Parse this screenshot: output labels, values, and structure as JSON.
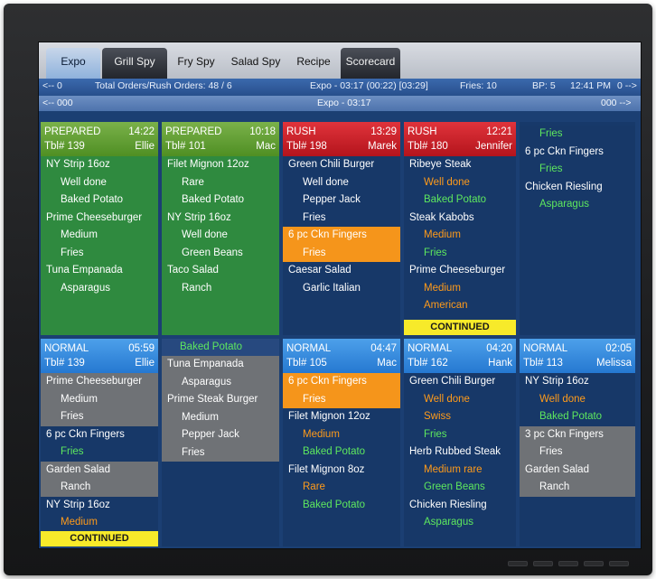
{
  "tabs": [
    {
      "label": "Expo",
      "style": "active"
    },
    {
      "label": "Grill Spy",
      "style": "dark"
    },
    {
      "label": "Fry Spy",
      "style": "plain"
    },
    {
      "label": "Salad Spy",
      "style": "plain"
    },
    {
      "label": "Recipe",
      "style": "plain"
    },
    {
      "label": "Scorecard",
      "style": "dark"
    }
  ],
  "infobar1": {
    "left_nav": "<-- 0",
    "orders": "Total Orders/Rush Orders: 48 / 6",
    "expo_time": "Expo  - 03:17 (00:22) [03:29]",
    "fries": "Fries: 10",
    "bp": "BP: 5",
    "clock": "12:41 PM",
    "right_nav": "0 -->"
  },
  "infobar2": {
    "left_nav": "<-- 000",
    "center": "Expo - 03:17",
    "right_nav": "000 -->"
  },
  "row1": [
    {
      "status": "PREPARED",
      "time": "14:22",
      "table": "Tbl# 139",
      "server": "Ellie",
      "header_color": "prep",
      "items": [
        {
          "text": "NY Strip 16oz",
          "level": 1,
          "color": "white"
        },
        {
          "text": "Well done",
          "level": 2,
          "color": "white"
        },
        {
          "text": "Baked Potato",
          "level": 2,
          "color": "white"
        },
        {
          "text": "Prime Cheeseburger",
          "level": 1,
          "color": "white"
        },
        {
          "text": "Medium",
          "level": 2,
          "color": "white"
        },
        {
          "text": "Fries",
          "level": 2,
          "color": "white"
        },
        {
          "text": "Tuna Empanada",
          "level": 1,
          "color": "white"
        },
        {
          "text": "Asparagus",
          "level": 2,
          "color": "white"
        }
      ]
    },
    {
      "status": "PREPARED",
      "time": "10:18",
      "table": "Tbl# 101",
      "server": "Mac",
      "header_color": "prep",
      "items": [
        {
          "text": "Filet Mignon 12oz",
          "level": 1,
          "color": "white"
        },
        {
          "text": "Rare",
          "level": 2,
          "color": "white"
        },
        {
          "text": "Baked Potato",
          "level": 2,
          "color": "white"
        },
        {
          "text": "NY Strip 16oz",
          "level": 1,
          "color": "white"
        },
        {
          "text": "Well done",
          "level": 2,
          "color": "white"
        },
        {
          "text": "Green Beans",
          "level": 2,
          "color": "white"
        },
        {
          "text": "Taco Salad",
          "level": 1,
          "color": "white"
        },
        {
          "text": "Ranch",
          "level": 2,
          "color": "white"
        }
      ]
    },
    {
      "status": "RUSH",
      "time": "13:29",
      "table": "Tbl# 198",
      "server": "Marek",
      "header_color": "rush",
      "items": [
        {
          "text": "Green Chili Burger",
          "level": 1,
          "color": "white"
        },
        {
          "text": "Well done",
          "level": 2,
          "color": "white"
        },
        {
          "text": "Pepper Jack",
          "level": 2,
          "color": "white"
        },
        {
          "text": "Fries",
          "level": 2,
          "color": "white"
        },
        {
          "text": "6 pc Ckn Fingers",
          "level": 1,
          "color": "white",
          "bg": "orange"
        },
        {
          "text": "Fries",
          "level": 2,
          "color": "white",
          "bg": "orange"
        },
        {
          "text": "Caesar Salad",
          "level": 1,
          "color": "white"
        },
        {
          "text": "Garlic Italian",
          "level": 2,
          "color": "white"
        }
      ]
    },
    {
      "status": "RUSH",
      "time": "12:21",
      "table": "Tbl# 180",
      "server": "Jennifer",
      "header_color": "rush",
      "continued": "CONTINUED",
      "items": [
        {
          "text": "Ribeye Steak",
          "level": 1,
          "color": "white"
        },
        {
          "text": "Well done",
          "level": 2,
          "color": "orange"
        },
        {
          "text": "Baked Potato",
          "level": 2,
          "color": "green"
        },
        {
          "text": "Steak Kabobs",
          "level": 1,
          "color": "white"
        },
        {
          "text": "Medium",
          "level": 2,
          "color": "orange"
        },
        {
          "text": "Fries",
          "level": 2,
          "color": "green"
        },
        {
          "text": "Prime Cheeseburger",
          "level": 1,
          "color": "white"
        },
        {
          "text": "Medium",
          "level": 2,
          "color": "orange"
        },
        {
          "text": "American",
          "level": 2,
          "color": "orange"
        }
      ]
    },
    {
      "status": "",
      "time": "",
      "table": "",
      "server": "",
      "header_color": "none",
      "items": [
        {
          "text": "Fries",
          "level": 2,
          "color": "green"
        },
        {
          "text": "6 pc Ckn Fingers",
          "level": 1,
          "color": "white"
        },
        {
          "text": "Fries",
          "level": 2,
          "color": "green"
        },
        {
          "text": "Chicken Riesling",
          "level": 1,
          "color": "white"
        },
        {
          "text": "Asparagus",
          "level": 2,
          "color": "green"
        }
      ]
    }
  ],
  "row2": [
    {
      "status": "NORMAL",
      "time": "05:59",
      "table": "Tbl# 139",
      "server": "Ellie",
      "header_color": "normal",
      "continued": "CONTINUED",
      "items": [
        {
          "text": "Prime Cheeseburger",
          "level": 1,
          "color": "white",
          "bg": "gray"
        },
        {
          "text": "Medium",
          "level": 2,
          "color": "white",
          "bg": "gray"
        },
        {
          "text": "Fries",
          "level": 2,
          "color": "white",
          "bg": "gray"
        },
        {
          "text": "6 pc Ckn Fingers",
          "level": 1,
          "color": "white"
        },
        {
          "text": "Fries",
          "level": 2,
          "color": "green"
        },
        {
          "text": "Garden Salad",
          "level": 1,
          "color": "white",
          "bg": "gray"
        },
        {
          "text": "Ranch",
          "level": 2,
          "color": "white",
          "bg": "gray"
        },
        {
          "text": "NY Strip 16oz",
          "level": 1,
          "color": "white"
        },
        {
          "text": "Medium",
          "level": 2,
          "color": "orange"
        }
      ]
    },
    {
      "status": "",
      "time": "",
      "table": "",
      "server": "",
      "header_color": "strip",
      "strip": "Baked Potato",
      "items": [
        {
          "text": "Tuna Empanada",
          "level": 1,
          "color": "white",
          "bg": "gray"
        },
        {
          "text": "Asparagus",
          "level": 2,
          "color": "white",
          "bg": "gray"
        },
        {
          "text": "Prime Steak Burger",
          "level": 1,
          "color": "white",
          "bg": "gray"
        },
        {
          "text": "Medium",
          "level": 2,
          "color": "white",
          "bg": "gray"
        },
        {
          "text": "Pepper Jack",
          "level": 2,
          "color": "white",
          "bg": "gray"
        },
        {
          "text": "Fries",
          "level": 2,
          "color": "white",
          "bg": "gray"
        }
      ]
    },
    {
      "status": "NORMAL",
      "time": "04:47",
      "table": "Tbl# 105",
      "server": "Mac",
      "header_color": "normal",
      "items": [
        {
          "text": "6 pc Ckn Fingers",
          "level": 1,
          "color": "white",
          "bg": "orange"
        },
        {
          "text": "Fries",
          "level": 2,
          "color": "white",
          "bg": "orange"
        },
        {
          "text": "Filet Mignon 12oz",
          "level": 1,
          "color": "white"
        },
        {
          "text": "Medium",
          "level": 2,
          "color": "orange"
        },
        {
          "text": "Baked Potato",
          "level": 2,
          "color": "green"
        },
        {
          "text": "Filet Mignon 8oz",
          "level": 1,
          "color": "white"
        },
        {
          "text": "Rare",
          "level": 2,
          "color": "orange"
        },
        {
          "text": "Baked Potato",
          "level": 2,
          "color": "green"
        }
      ]
    },
    {
      "status": "NORMAL",
      "time": "04:20",
      "table": "Tbl# 162",
      "server": "Hank",
      "header_color": "normal",
      "items": [
        {
          "text": "Green Chili Burger",
          "level": 1,
          "color": "white"
        },
        {
          "text": "Well done",
          "level": 2,
          "color": "orange"
        },
        {
          "text": "Swiss",
          "level": 2,
          "color": "orange"
        },
        {
          "text": "Fries",
          "level": 2,
          "color": "green"
        },
        {
          "text": "Herb Rubbed Steak",
          "level": 1,
          "color": "white"
        },
        {
          "text": "Medium rare",
          "level": 2,
          "color": "orange"
        },
        {
          "text": "Green Beans",
          "level": 2,
          "color": "green"
        },
        {
          "text": "Chicken Riesling",
          "level": 1,
          "color": "white"
        },
        {
          "text": "Asparagus",
          "level": 2,
          "color": "green"
        }
      ]
    },
    {
      "status": "NORMAL",
      "time": "02:05",
      "table": "Tbl# 113",
      "server": "Melissa",
      "header_color": "normal",
      "items": [
        {
          "text": "NY Strip 16oz",
          "level": 1,
          "color": "white"
        },
        {
          "text": "Well done",
          "level": 2,
          "color": "orange"
        },
        {
          "text": "Baked Potato",
          "level": 2,
          "color": "green"
        },
        {
          "text": "3 pc Ckn Fingers",
          "level": 1,
          "color": "white",
          "bg": "gray"
        },
        {
          "text": "Fries",
          "level": 2,
          "color": "white",
          "bg": "gray"
        },
        {
          "text": "Garden Salad",
          "level": 1,
          "color": "white",
          "bg": "gray"
        },
        {
          "text": "Ranch",
          "level": 2,
          "color": "white",
          "bg": "gray"
        }
      ]
    }
  ]
}
